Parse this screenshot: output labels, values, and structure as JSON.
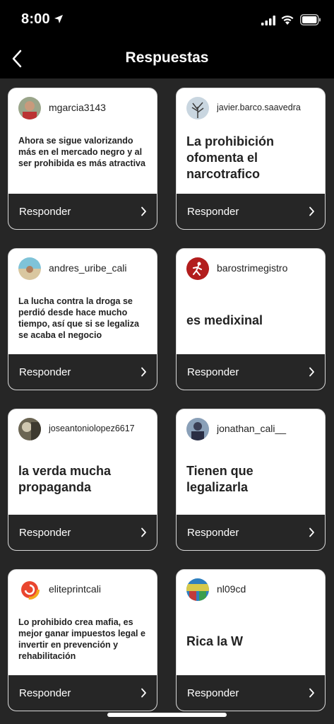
{
  "status_bar": {
    "time": "8:00"
  },
  "nav": {
    "title": "Respuestas",
    "back_icon": "chevron-left-icon"
  },
  "reply_label": "Responder",
  "cards": [
    {
      "username": "mgarcia3143",
      "message": "Ahora se sigue valorizando más en el mercado negro y al ser prohibida es más atractiva"
    },
    {
      "username": "javier.barco.saavedra",
      "message": "La prohibición ofomenta el narcotrafico"
    },
    {
      "username": "andres_uribe_cali",
      "message": "La lucha contra la droga se perdió desde hace mucho tiempo, así que si se legaliza se acaba el negocio"
    },
    {
      "username": "barostrimegistro",
      "message": "es medixinal"
    },
    {
      "username": "joseantoniolopez6617",
      "message": "la verda mucha propaganda"
    },
    {
      "username": "jonathan_cali__",
      "message": "Tienen que legalizarla"
    },
    {
      "username": "eliteprintcali",
      "message": "Lo prohibido crea mafia, es mejor ganar impuestos legal e invertir en prevención y rehabilitación"
    },
    {
      "username": "nl09cd",
      "message": "Rica la W"
    }
  ]
}
